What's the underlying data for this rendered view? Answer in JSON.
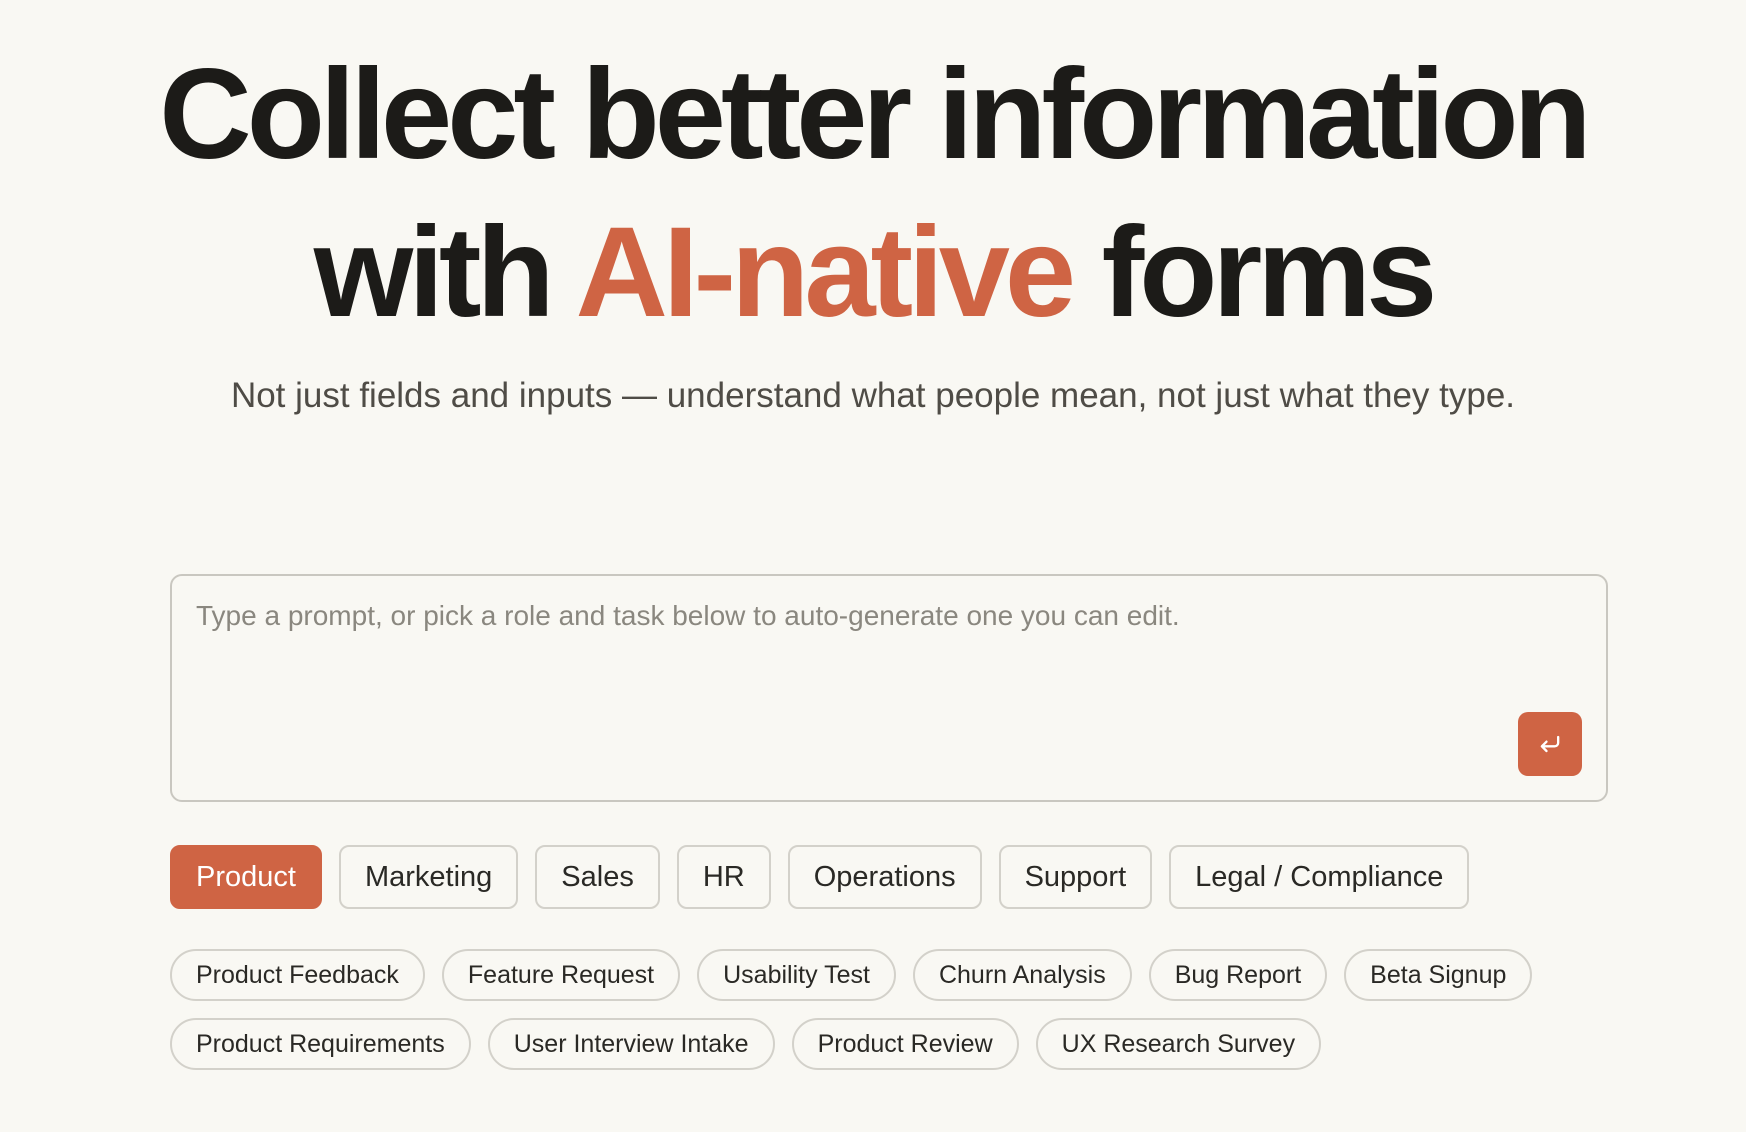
{
  "hero": {
    "line1": "Collect better information",
    "line2_prefix": "with",
    "line2_accent": "AI-native",
    "line2_suffix": "forms",
    "subtitle": "Not just fields and inputs — understand what people mean, not just what they type."
  },
  "prompt": {
    "placeholder": "Type a prompt, or pick a role and task below to auto-generate one you can edit.",
    "value": "",
    "submit_icon": "return-arrow-icon"
  },
  "roles": {
    "selected": "Product",
    "items": [
      "Product",
      "Marketing",
      "Sales",
      "HR",
      "Operations",
      "Support",
      "Legal / Compliance"
    ]
  },
  "tasks": {
    "row1": [
      "Product Feedback",
      "Feature Request",
      "Usability Test",
      "Churn Analysis",
      "Bug Report",
      "Beta Signup"
    ],
    "row2": [
      "Product Requirements",
      "User Interview Intake",
      "Product Review",
      "UX Research Survey"
    ]
  },
  "colors": {
    "accent": "#cf6444",
    "background": "#f9f8f3",
    "text": "#1c1b18",
    "muted": "#4f4c46",
    "border": "#d3d1ca"
  }
}
